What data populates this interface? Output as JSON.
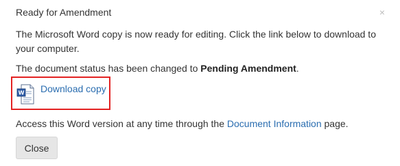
{
  "dialog": {
    "title": "Ready for Amendment",
    "close_symbol": "×",
    "message_ready": "The Microsoft Word copy is now ready for editing. Click the link below to download to your computer.",
    "status_prefix": "The document status has been changed to ",
    "status_value": "Pending Amendment",
    "status_suffix": ".",
    "download_label": "Download copy",
    "download_icon": "word-document-icon",
    "access_prefix": "Access this Word version at any time through the ",
    "access_link": "Document Information",
    "access_suffix": " page.",
    "close_button_label": "Close"
  },
  "colors": {
    "link": "#2a6db0",
    "highlight_border": "#e32121",
    "button_bg": "#e6e6e6",
    "text": "#333333"
  }
}
